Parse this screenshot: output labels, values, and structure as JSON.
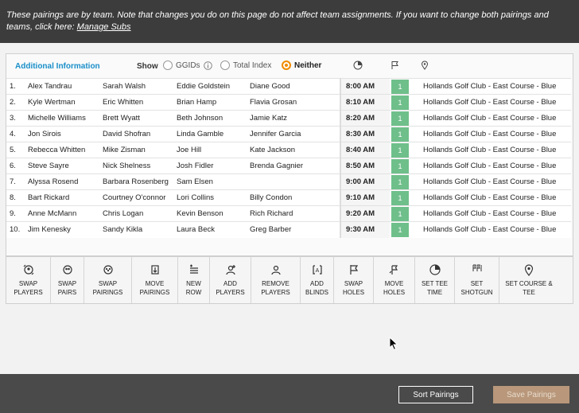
{
  "banner": {
    "text": "These pairings are by team. Note that changes you do on this page do not affect team assignments. If you want to change both pairings and teams, click here:",
    "link": "Manage Subs"
  },
  "filters": {
    "additional_info": "Additional Information",
    "show_label": "Show",
    "options": [
      {
        "label": "GGIDs",
        "selected": false
      },
      {
        "label": "Total Index",
        "selected": false
      },
      {
        "label": "Neither",
        "selected": true
      }
    ],
    "accent_color": "#f08c00"
  },
  "pairings": [
    {
      "num": "1.",
      "players": [
        "Alex Tandrau",
        "Sarah Walsh",
        "Eddie Goldstein",
        "Diane Good"
      ],
      "time": "8:00 AM",
      "hole": "1",
      "course": "Hollands Golf Club - East Course - Blue"
    },
    {
      "num": "2.",
      "players": [
        "Kyle Wertman",
        "Eric Whitten",
        "Brian Hamp",
        "Flavia Grosan"
      ],
      "time": "8:10 AM",
      "hole": "1",
      "course": "Hollands Golf Club - East Course - Blue"
    },
    {
      "num": "3.",
      "players": [
        "Michelle Williams",
        "Brett Wyatt",
        "Beth Johnson",
        "Jamie Katz"
      ],
      "time": "8:20 AM",
      "hole": "1",
      "course": "Hollands Golf Club - East Course - Blue"
    },
    {
      "num": "4.",
      "players": [
        "Jon Sirois",
        "David Shofran",
        "Linda Gamble",
        "Jennifer Garcia"
      ],
      "time": "8:30 AM",
      "hole": "1",
      "course": "Hollands Golf Club - East Course - Blue"
    },
    {
      "num": "5.",
      "players": [
        "Rebecca Whitten",
        "Mike Zisman",
        "Joe Hill",
        "Kate Jackson"
      ],
      "time": "8:40 AM",
      "hole": "1",
      "course": "Hollands Golf Club - East Course - Blue"
    },
    {
      "num": "6.",
      "players": [
        "Steve Sayre",
        "Nick Shelness",
        "Josh Fidler",
        "Brenda Gagnier"
      ],
      "time": "8:50 AM",
      "hole": "1",
      "course": "Hollands Golf Club - East Course - Blue"
    },
    {
      "num": "7.",
      "players": [
        "Alyssa Rosend",
        "Barbara Rosenberg",
        "Sam Elsen",
        ""
      ],
      "time": "9:00 AM",
      "hole": "1",
      "course": "Hollands Golf Club - East Course - Blue"
    },
    {
      "num": "8.",
      "players": [
        "Bart Rickard",
        "Courtney O'connor",
        "Lori Collins",
        "Billy Condon"
      ],
      "time": "9:10 AM",
      "hole": "1",
      "course": "Hollands Golf Club - East Course - Blue"
    },
    {
      "num": "9.",
      "players": [
        "Anne McMann",
        "Chris Logan",
        "Kevin Benson",
        "Rich Richard"
      ],
      "time": "9:20 AM",
      "hole": "1",
      "course": "Hollands Golf Club - East Course - Blue"
    },
    {
      "num": "10.",
      "players": [
        "Jim Kenesky",
        "Sandy Kikla",
        "Laura Beck",
        "Greg Barber"
      ],
      "time": "9:30 AM",
      "hole": "1",
      "course": "Hollands Golf Club - East Course - Blue"
    }
  ],
  "toolbar": [
    {
      "line1": "SWAP",
      "line2": "PLAYERS",
      "icon": "swap-players-icon"
    },
    {
      "line1": "SWAP",
      "line2": "PAIRS",
      "icon": "swap-pairs-icon"
    },
    {
      "line1": "SWAP",
      "line2": "PAIRINGS",
      "icon": "swap-pairings-icon"
    },
    {
      "line1": "MOVE",
      "line2": "PAIRINGS",
      "icon": "move-pairings-icon"
    },
    {
      "line1": "NEW",
      "line2": "ROW",
      "icon": "new-row-icon"
    },
    {
      "line1": "ADD",
      "line2": "PLAYERS",
      "icon": "add-players-icon"
    },
    {
      "line1": "REMOVE",
      "line2": "PLAYERS",
      "icon": "remove-players-icon"
    },
    {
      "line1": "ADD",
      "line2": "BLINDS",
      "icon": "add-blinds-icon"
    },
    {
      "line1": "SWAP",
      "line2": "HOLES",
      "icon": "swap-holes-icon"
    },
    {
      "line1": "MOVE",
      "line2": "HOLES",
      "icon": "move-holes-icon"
    },
    {
      "line1": "SET TEE",
      "line2": "TIME",
      "icon": "tee-time-icon"
    },
    {
      "line1": "SET",
      "line2": "SHOTGUN",
      "icon": "shotgun-icon"
    },
    {
      "line1": "SET COURSE &",
      "line2": "TEE",
      "icon": "course-pin-icon"
    }
  ],
  "footer": {
    "sort_label": "Sort Pairings",
    "save_label": "Save Pairings"
  }
}
